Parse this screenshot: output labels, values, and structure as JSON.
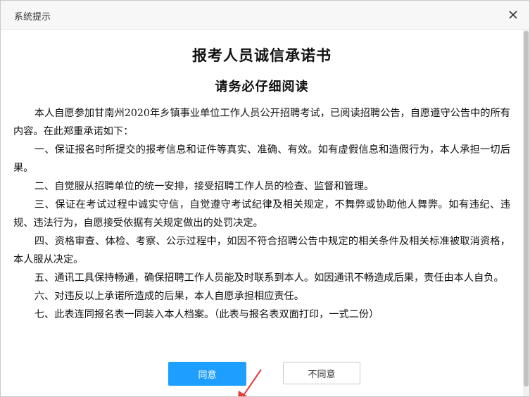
{
  "dialog": {
    "title": "系统提示",
    "close_icon": "close-icon"
  },
  "document": {
    "title": "报考人员诚信承诺书",
    "subtitle": "请务必仔细阅读",
    "paragraphs": [
      "本人自愿参加甘南州2020年乡镇事业单位工作人员公开招聘考试，已阅读招聘公告，自愿遵守公告中的所有内容。在此郑重承诺如下：",
      "一、保证报名时所提交的报考信息和证件等真实、准确、有效。如有虚假信息和造假行为，本人承担一切后果。",
      "二、自觉服从招聘单位的统一安排，接受招聘工作人员的检查、监督和管理。",
      "三、保证在考试过程中诚实守信，自觉遵守考试纪律及相关规定，不舞弊或协助他人舞弊。如有违纪、违规、违法行为，自愿接受依据有关规定做出的处罚决定。",
      "四、资格审查、体检、考察、公示过程中，如因不符合招聘公告中规定的相关条件及相关标准被取消资格，本人服从决定。",
      "五、通讯工具保持畅通，确保招聘工作人员能及时联系到本人。如因通讯不畅造成后果，责任由本人自负。",
      "六、对违反以上承诺所造成的后果，本人自愿承担相应责任。",
      "七、此表连同报名表一同装入本人档案。（此表与报名表双面打印，一式二份）"
    ]
  },
  "buttons": {
    "agree": "同意",
    "disagree": "不同意"
  },
  "colors": {
    "agree_bg": "#1e9fff",
    "annotation_arrow": "#e83a3a"
  }
}
